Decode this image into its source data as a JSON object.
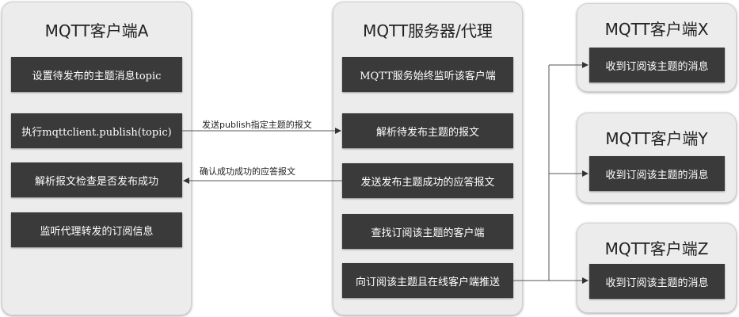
{
  "client_a": {
    "title": "MQTT客户端A",
    "steps": [
      "设置待发布的主题消息topic",
      "执行mqttclient.publish(topic)",
      "解析报文检查是否发布成功",
      "监听代理转发的订阅信息"
    ]
  },
  "broker": {
    "title": "MQTT服务器/代理",
    "steps": [
      "MQTT服务始终监听该客户端",
      "解析待发布主题的报文",
      "发送发布主题成功的应答报文",
      "查找订阅该主题的客户端",
      "向订阅该主题且在线客户端推送"
    ]
  },
  "client_x": {
    "title": "MQTT客户端X",
    "step": "收到订阅该主题的消息"
  },
  "client_y": {
    "title": "MQTT客户端Y",
    "step": "收到订阅该主题的消息"
  },
  "client_z": {
    "title": "MQTT客户端Z",
    "step": "收到订阅该主题的消息"
  },
  "messages": {
    "publish": "发送publish指定主题的报文",
    "ack": "确认成功成功的应答报文"
  }
}
